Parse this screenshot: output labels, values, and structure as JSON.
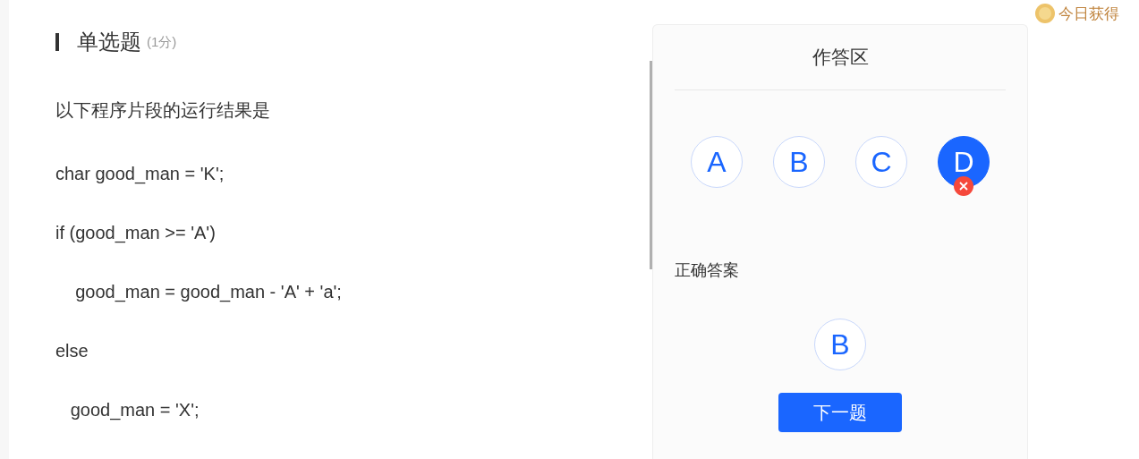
{
  "question": {
    "type": "单选题",
    "score": "(1分)",
    "prompt": "以下程序片段的运行结果是",
    "code_lines": [
      "char good_man = 'K';",
      "if (good_man >= 'A')",
      "    good_man = good_man - 'A' + 'a';",
      "else",
      "   good_man = 'X';"
    ]
  },
  "reward": {
    "label": "今日获得"
  },
  "answer_panel": {
    "title": "作答区",
    "options": [
      {
        "label": "A",
        "selected": false,
        "wrong": false
      },
      {
        "label": "B",
        "selected": false,
        "wrong": false
      },
      {
        "label": "C",
        "selected": false,
        "wrong": false
      },
      {
        "label": "D",
        "selected": true,
        "wrong": true
      }
    ],
    "correct_label": "正确答案",
    "correct_answer": "B",
    "next_button": "下一题"
  }
}
